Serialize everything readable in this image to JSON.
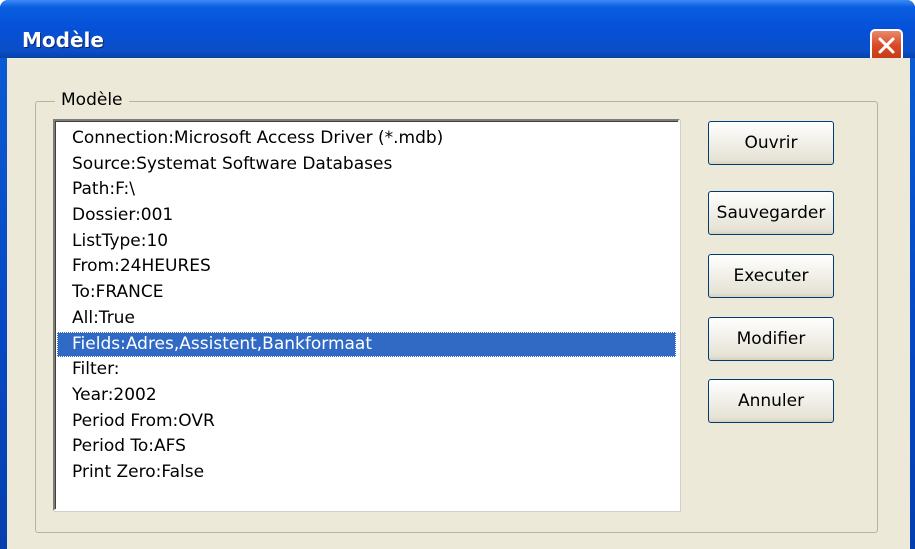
{
  "window": {
    "title": "Modèle",
    "close_icon": "close-icon"
  },
  "group": {
    "label": "Modèle"
  },
  "list": {
    "items": [
      "Connection:Microsoft Access Driver (*.mdb)",
      "Source:Systemat Software Databases",
      "Path:F:\\",
      "Dossier:001",
      "ListType:10",
      "From:24HEURES",
      "To:FRANCE",
      "All:True",
      "Fields:Adres,Assistent,Bankformaat",
      "Filter:",
      "Year:2002",
      "Period From:OVR",
      "Period To:AFS",
      "Print Zero:False"
    ],
    "selected_index": 8
  },
  "buttons": {
    "open": "Ouvrir",
    "save": "Sauvegarder",
    "execute": "Executer",
    "modify": "Modifier",
    "cancel": "Annuler"
  },
  "colors": {
    "titlebar": "#0550d8",
    "selection": "#316ac5",
    "dialog_bg": "#ece9d8",
    "close_button": "#d94a26"
  }
}
